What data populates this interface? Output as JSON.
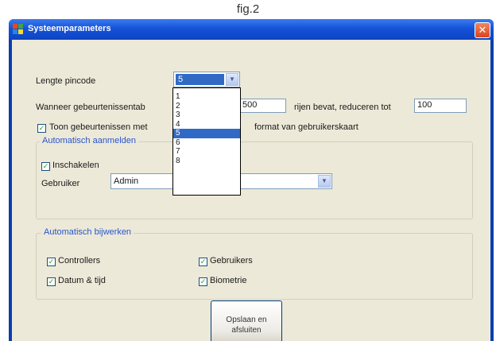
{
  "caption": "fig.2",
  "window": {
    "title": "Systeemparameters"
  },
  "pincode": {
    "label": "Lengte pincode",
    "value": "5"
  },
  "events": {
    "label_prefix": "Wanneer gebeurtenissentab",
    "value1": "500",
    "label_middle": "rijen bevat, reduceren tot",
    "value2": "100"
  },
  "show_events": {
    "label_left": "Toon gebeurtenissen met",
    "label_right": "format van gebruikerskaart",
    "checked": true
  },
  "auto_login": {
    "title": "Automatisch aanmelden",
    "enable_label": "Inschakelen",
    "enable_checked": true,
    "user_label": "Gebruiker",
    "user_value": "Admin"
  },
  "auto_update": {
    "title": "Automatisch bijwerken",
    "items": [
      {
        "label": "Controllers",
        "checked": true
      },
      {
        "label": "Gebruikers",
        "checked": true
      },
      {
        "label": "Datum & tijd",
        "checked": true
      },
      {
        "label": "Biometrie",
        "checked": true
      }
    ]
  },
  "dropdown": {
    "options": [
      "1",
      "2",
      "3",
      "4",
      "5",
      "6",
      "7",
      "8"
    ],
    "selected": "5"
  },
  "save_button": {
    "line1": "Opslaan en",
    "line2": "afsluiten"
  },
  "colors": {
    "title_bar": "#1552d8",
    "selection": "#316ac5",
    "group_title": "#2a55cc",
    "close": "#d8451f"
  }
}
